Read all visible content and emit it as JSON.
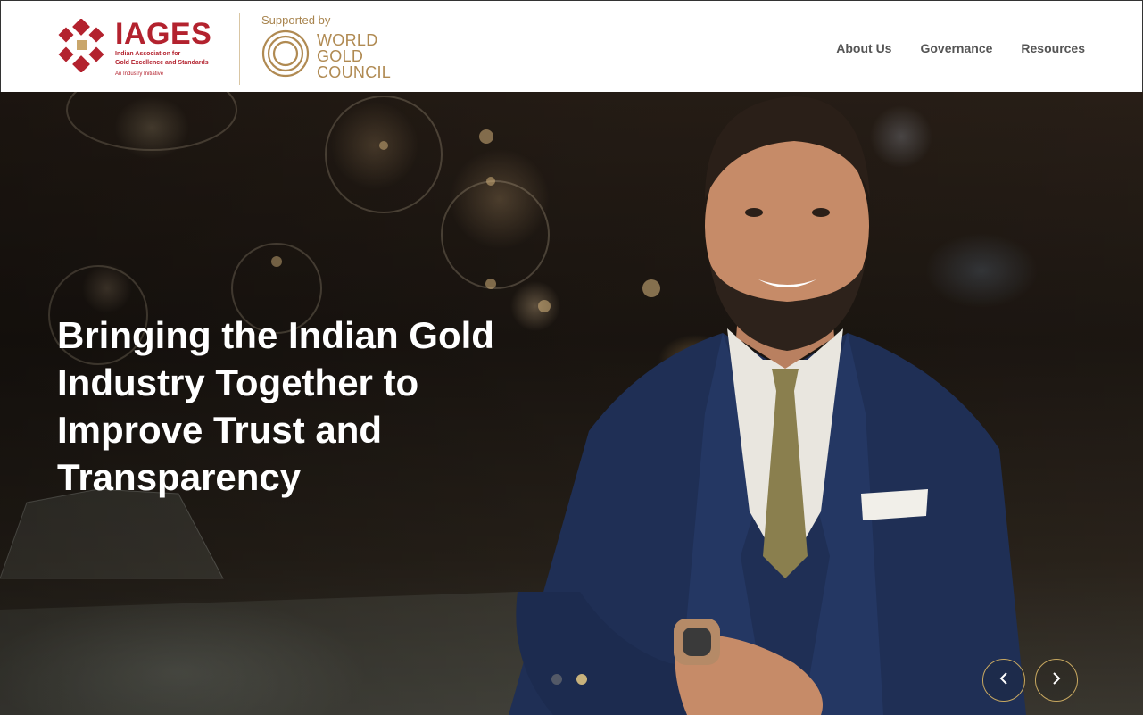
{
  "header": {
    "iages": {
      "title": "IAGES",
      "subtitle_line1": "Indian Association for",
      "subtitle_line2": "Gold Excellence and Standards",
      "initiative": "An Industry Initiative"
    },
    "wgc": {
      "supported_by": "Supported by",
      "line1": "WORLD",
      "line2": "GOLD",
      "line3": "COUNCIL"
    },
    "nav": [
      {
        "label": "About Us"
      },
      {
        "label": "Governance"
      },
      {
        "label": "Resources"
      }
    ]
  },
  "hero": {
    "headline_line1": "Bringing the Indian Gold",
    "headline_line2": "Industry Together to",
    "headline_line3": "Improve Trust and",
    "headline_line4": "Transparency",
    "slides_total": 2,
    "active_slide": 2
  },
  "colors": {
    "brand_red": "#b3222e",
    "gold": "#b08a52",
    "nav_text": "#555555"
  }
}
